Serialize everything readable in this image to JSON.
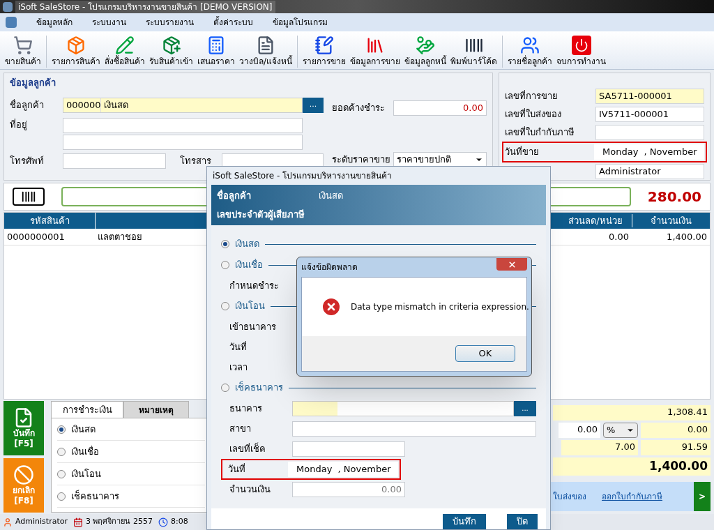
{
  "window": {
    "title": "iSoft SaleStore - โปรแกรมบริหารงานขายสินค้า [DEMO VERSION]"
  },
  "menu": [
    "ข้อมูลหลัก",
    "ระบบงาน",
    "ระบบรายงาน",
    "ตั้งค่าระบบ",
    "ข้อมูลโปรแกรม"
  ],
  "toolbar": [
    [
      {
        "label": "ขายสินค้า"
      }
    ],
    [
      {
        "label": "รายการสินค้า"
      },
      {
        "label": "สั่งซื้อสินค้า"
      },
      {
        "label": "รับสินค้าเข้า"
      },
      {
        "label": "เสนอราคา"
      },
      {
        "label": "วางบิล/แจ้งหนี้"
      }
    ],
    [
      {
        "label": "รายการขาย"
      },
      {
        "label": "ข้อมูลการขาย"
      },
      {
        "label": "ข้อมูลลูกหนี้"
      },
      {
        "label": "พิมพ์บาร์โค้ด"
      }
    ],
    [
      {
        "label": "รายชื่อลูกค้า"
      },
      {
        "label": "จบการทำงาน"
      }
    ]
  ],
  "customer": {
    "title": "ข้อมูลลูกค้า",
    "name_label": "ชื่อลูกค้า",
    "code": "000000",
    "name": "เงินสด",
    "browse": "...",
    "address_label": "ที่อยู่",
    "phone_label": "โทรศัพท์",
    "fax_label": "โทรสาร",
    "balance_label": "ยอดค้างชำระ",
    "balance": "0.00",
    "price_level_label": "ระดับราคาขาย",
    "price_level": "ราคาขายปกติ"
  },
  "sale_info": [
    {
      "kind": "text",
      "label": "เลขที่การขาย",
      "value": "SA5711-000001",
      "highlight": true
    },
    {
      "kind": "text",
      "label": "เลขที่ใบส่งของ",
      "value": "IV5711-000001",
      "highlight": false
    },
    {
      "kind": "text",
      "label": "เลขที่ใบกำกับภาษี",
      "highlight": false
    },
    {
      "kind": "date",
      "label": "วันที่ขาย",
      "value": "Monday  , November",
      "annotated": true
    },
    {
      "kind": "text",
      "value": "Administrator",
      "highlight": false
    }
  ],
  "scan": {
    "total": "280.00"
  },
  "table": {
    "columns": [
      "รหัสสินค้า",
      "",
      "ส่วนลด/หน่วย",
      "จำนวนเงิน"
    ],
    "rows": [
      {
        "cells": [
          "0000000001",
          "แลตตาชอย",
          "0.00",
          "1,400.00"
        ]
      }
    ]
  },
  "actions": [
    {
      "kind": "save",
      "label": "บันทึก",
      "key": "[F5]"
    },
    {
      "kind": "cancel",
      "label": "ยกเลิก",
      "key": "[F8]"
    }
  ],
  "tabs": [
    {
      "label": "การชำระเงิน",
      "selected": true
    },
    {
      "label": "หมายเหตุ",
      "selected": false
    }
  ],
  "payment_options": [
    {
      "label": "เงินสด",
      "selected": true
    },
    {
      "label": "เงินเชื่อ",
      "selected": false
    },
    {
      "label": "เงินโอน",
      "selected": false
    },
    {
      "label": "เช็คธนาคาร",
      "selected": false
    }
  ],
  "summary": {
    "subtotal": "1,308.41",
    "discount": "0.00",
    "discount_unit": "%",
    "discount_amount": "0.00",
    "vat_rate": "7.00",
    "vat": "91.59",
    "total": "1,400.00"
  },
  "links": [
    "ใบส่งของ",
    "ออกใบกำกับภาษี"
  ],
  "next_button": ">",
  "status_bar": {
    "user": "Administrator",
    "date": "3 พฤศจิกายน 2557",
    "time": "8:08"
  },
  "payment_dialog": {
    "title": "iSoft SaleStore - โปรแกรมบริหารงานขายสินค้า",
    "customer_label": "ชื่อลูกค้า",
    "customer": "เงินสด",
    "tax_id_label": "เลขประจำตัวผู้เสียภาษี",
    "sections": [
      {
        "label": "เงินสด",
        "selected": true
      },
      {
        "label": "เงินเชื่อ",
        "selected": false,
        "fields": [
          {
            "kind": "label",
            "label": "กำหนดชำระ"
          }
        ]
      },
      {
        "label": "เงินโอน",
        "selected": false,
        "fields": [
          {
            "kind": "label",
            "label": "เข้าธนาคาร"
          },
          {
            "kind": "label",
            "label": "วันที่"
          },
          {
            "kind": "label",
            "label": "เวลา"
          }
        ]
      },
      {
        "label": "เช็คธนาคาร",
        "selected": false,
        "fields": [
          {
            "kind": "lookup",
            "label": "ธนาคาร",
            "browse": "..."
          },
          {
            "kind": "wide",
            "label": "สาขา"
          },
          {
            "kind": "short",
            "label": "เลขที่เช็ค"
          },
          {
            "kind": "date",
            "label": "วันที่",
            "value": "Monday  , November",
            "annotated": true
          },
          {
            "kind": "amount",
            "label": "จำนวนเงิน",
            "placeholder": "0.00"
          }
        ]
      }
    ],
    "buttons": [
      "บันทึก",
      "ปิด"
    ]
  },
  "error_dialog": {
    "title": "แจ้งข้อผิดพลาด",
    "message": "Data type mismatch in criteria expression.",
    "button": "OK"
  }
}
